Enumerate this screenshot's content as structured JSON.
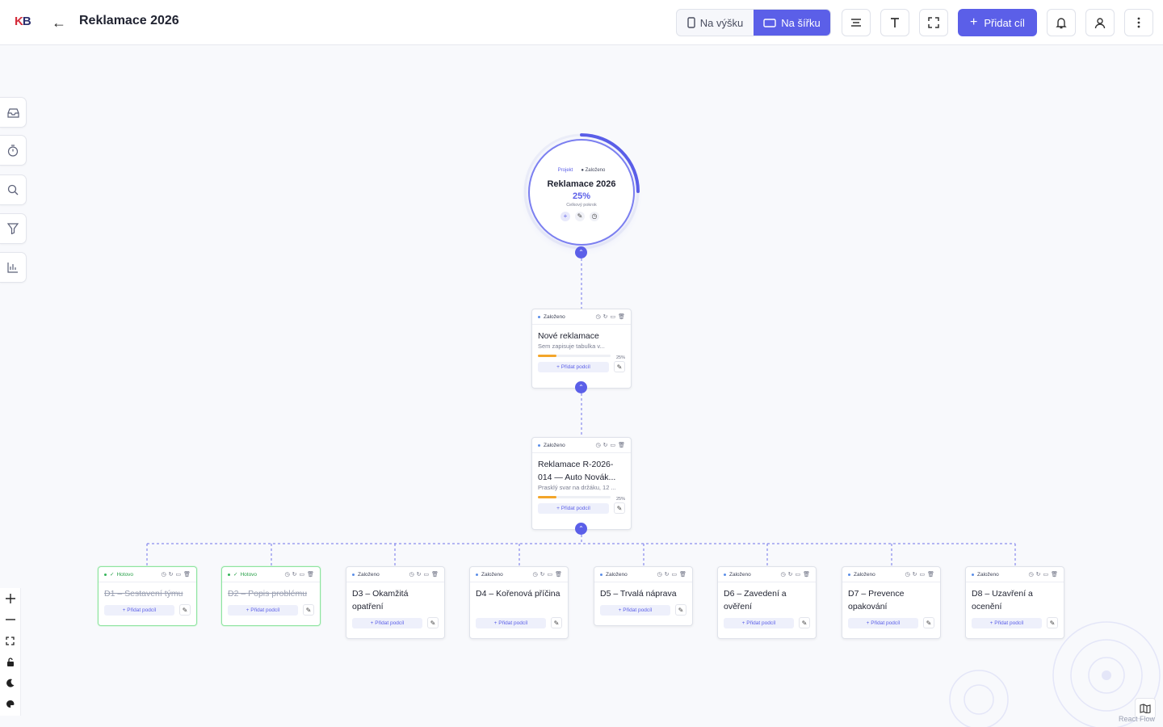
{
  "header": {
    "logo_k": "K",
    "logo_b": "B",
    "back_icon": "arrow-left-icon",
    "title": "Reklamace 2026",
    "orientation": {
      "portrait": "Na výšku",
      "landscape": "Na šířku",
      "active": "landscape"
    },
    "add_goal": "Přidat cíl"
  },
  "root": {
    "tag_type": "Projekt",
    "tag_status": "Založeno",
    "name": "Reklamace 2026",
    "progress_pct": 25,
    "progress_label": "25%",
    "progress_caption": "Celkový pokrok"
  },
  "nodes": [
    {
      "status": "Založeno",
      "name": "Nové reklamace",
      "desc": "Sem zapisuje tabulka v...",
      "progress_pct": 25,
      "progress_label": "25%",
      "add_label": "Přidat podcíl"
    },
    {
      "status": "Založeno",
      "name": "Reklamace R-2026-014 — Auto Novák...",
      "desc": "Prasklý svar na držáku, 12 ...",
      "progress_pct": 25,
      "progress_label": "25%",
      "add_label": "Přidat podcíl"
    }
  ],
  "children": [
    {
      "status": "Hotovo",
      "done": true,
      "name": "D1 – Sestavení týmu",
      "add_label": "Přidat podcíl"
    },
    {
      "status": "Hotovo",
      "done": true,
      "name": "D2 – Popis problému",
      "add_label": "Přidat podcíl"
    },
    {
      "status": "Založeno",
      "done": false,
      "name": "D3 – Okamžitá opatření",
      "add_label": "Přidat podcíl"
    },
    {
      "status": "Založeno",
      "done": false,
      "name": "D4 – Kořenová příčina",
      "add_label": "Přidat podcíl"
    },
    {
      "status": "Založeno",
      "done": false,
      "name": "D5 – Trvalá náprava",
      "add_label": "Přidat podcíl"
    },
    {
      "status": "Založeno",
      "done": false,
      "name": "D6 – Zavedení a ověření",
      "add_label": "Přidat podcíl"
    },
    {
      "status": "Založeno",
      "done": false,
      "name": "D7 – Prevence opakování",
      "add_label": "Přidat podcíl"
    },
    {
      "status": "Založeno",
      "done": false,
      "name": "D8 – Uzavření a ocenění",
      "add_label": "Přidat podcíl"
    }
  ],
  "sidebar": [
    "inbox-icon",
    "timer-icon",
    "search-icon",
    "filter-icon",
    "chart-icon"
  ],
  "zoom_controls": [
    "zoom-in-icon",
    "zoom-out-icon",
    "fit-view-icon",
    "lock-icon",
    "moon-icon",
    "palette-icon"
  ],
  "attribution": "React Flow",
  "colors": {
    "accent": "#5b5fe8",
    "done": "#35b55a",
    "progress": "#f3a52a"
  }
}
